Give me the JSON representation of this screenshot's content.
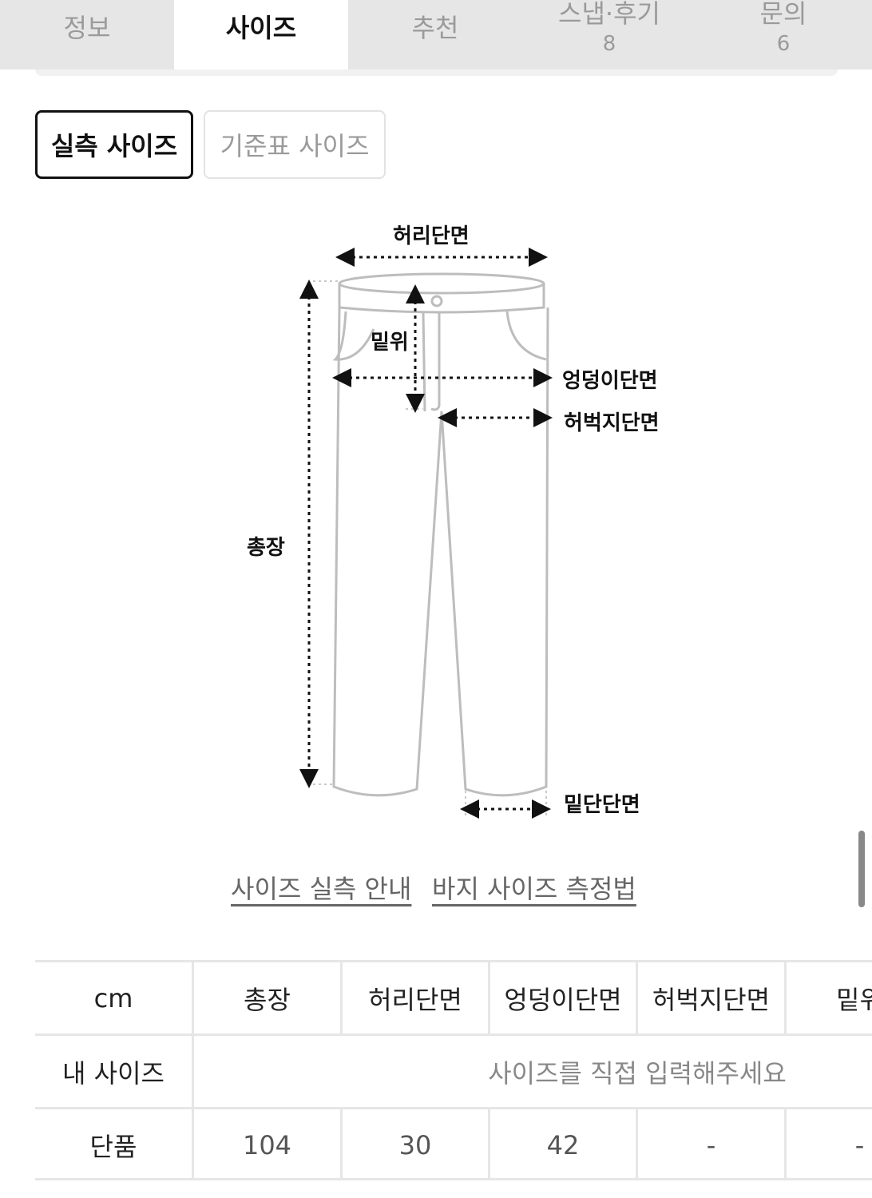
{
  "tabs": [
    {
      "label": "정보",
      "count": ""
    },
    {
      "label": "사이즈",
      "count": ""
    },
    {
      "label": "추천",
      "count": ""
    },
    {
      "label": "스냅·후기",
      "count": "8"
    },
    {
      "label": "문의",
      "count": "6"
    }
  ],
  "active_tab": "사이즈",
  "size_toggle": {
    "measured_label": "실측 사이즈",
    "standard_label": "기준표 사이즈"
  },
  "diagram": {
    "waist_label": "허리단면",
    "rise_label": "밑위",
    "hip_label": "엉덩이단면",
    "thigh_label": "허벅지단면",
    "length_label": "총장",
    "hem_label": "밑단단면"
  },
  "links": {
    "size_guide": "사이즈 실측 안내",
    "pants_measure": "바지 사이즈 측정법"
  },
  "table": {
    "unit": "cm",
    "columns": [
      "총장",
      "허리단면",
      "엉덩이단면",
      "허벅지단면",
      "밑위"
    ],
    "my_size_label": "내 사이즈",
    "my_size_placeholder": "사이즈를 직접 입력해주세요",
    "product_label": "단품",
    "product_values": [
      "104",
      "30",
      "42",
      "-",
      "-"
    ]
  },
  "colors": {
    "tab_bg": "#e6e6e6",
    "active_border": "#111111",
    "line": "#e6e6e6"
  }
}
